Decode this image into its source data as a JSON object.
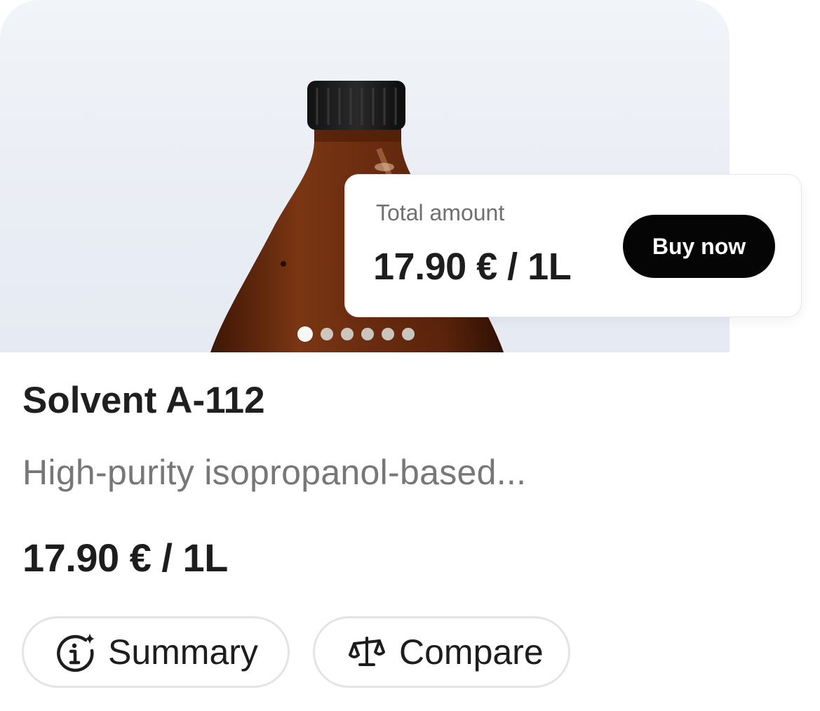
{
  "product": {
    "name": "Solvent A-112",
    "description": "High-purity isopropanol-based...",
    "price": "17.90 € / 1L",
    "image_icon": "amber-bottle-image"
  },
  "carousel": {
    "total_slides": 6,
    "active_index": 0
  },
  "price_card": {
    "label": "Total amount",
    "price": "17.90 € / 1L",
    "buy_label": "Buy now"
  },
  "actions": {
    "summary": {
      "label": "Summary",
      "icon": "info-sparkle-icon"
    },
    "compare": {
      "label": "Compare",
      "icon": "scale-icon"
    }
  },
  "colors": {
    "button_bg": "#050505",
    "bottle": "#6b2d12",
    "muted_text": "#777777"
  }
}
